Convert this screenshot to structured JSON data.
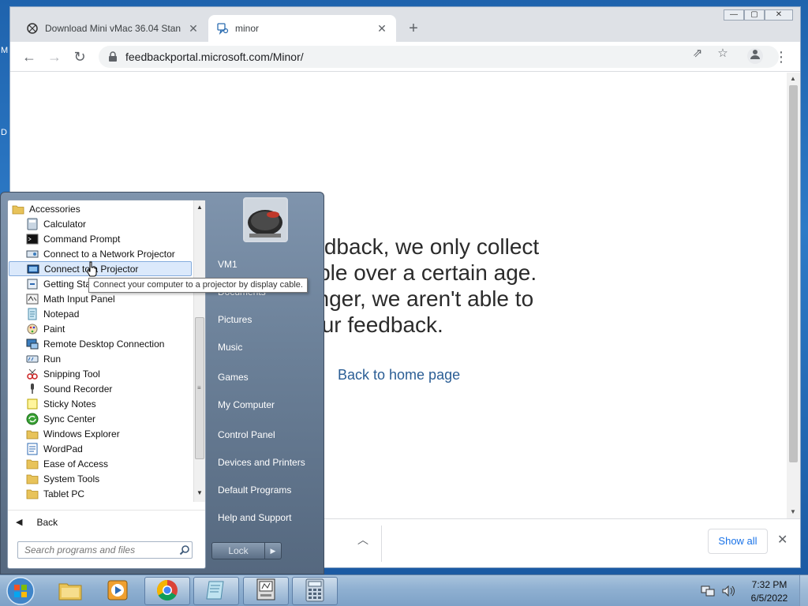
{
  "desktop": {
    "edge_letters": [
      "M",
      "D"
    ]
  },
  "browser": {
    "tabs": [
      {
        "title": "Download Mini vMac 36.04 Stan",
        "favicon": "minivmac-icon"
      },
      {
        "title": "minor",
        "favicon": "feedback-hub-icon"
      }
    ],
    "new_tab": "+",
    "window_controls": {
      "minimize": "—",
      "maximize": "▢",
      "close": "✕"
    },
    "url": "feedbackportal.microsoft.com/Minor/",
    "page": {
      "message": "ue feedback, we only collect\nn people over a certain age.\ne younger, we aren't able to\nect your feedback.",
      "home_link": "Back to home page"
    },
    "download_bar": {
      "show_all": "Show all"
    }
  },
  "start_menu": {
    "folder": "Accessories",
    "items": [
      {
        "label": "Calculator",
        "icon": "calculator-icon"
      },
      {
        "label": "Command Prompt",
        "icon": "command-prompt-icon"
      },
      {
        "label": "Connect to a Network Projector",
        "icon": "network-projector-icon"
      },
      {
        "label": "Connect to a Projector",
        "icon": "projector-icon",
        "selected": true
      },
      {
        "label": "Getting Started",
        "icon": "getting-started-icon"
      },
      {
        "label": "Math Input Panel",
        "icon": "math-input-icon"
      },
      {
        "label": "Notepad",
        "icon": "notepad-icon"
      },
      {
        "label": "Paint",
        "icon": "paint-icon"
      },
      {
        "label": "Remote Desktop Connection",
        "icon": "remote-desktop-icon"
      },
      {
        "label": "Run",
        "icon": "run-icon"
      },
      {
        "label": "Snipping Tool",
        "icon": "snipping-tool-icon"
      },
      {
        "label": "Sound Recorder",
        "icon": "sound-recorder-icon"
      },
      {
        "label": "Sticky Notes",
        "icon": "sticky-notes-icon"
      },
      {
        "label": "Sync Center",
        "icon": "sync-center-icon"
      },
      {
        "label": "Windows Explorer",
        "icon": "windows-explorer-icon"
      },
      {
        "label": "WordPad",
        "icon": "wordpad-icon"
      },
      {
        "label": "Ease of Access",
        "icon": "folder-icon"
      },
      {
        "label": "System Tools",
        "icon": "folder-icon"
      },
      {
        "label": "Tablet PC",
        "icon": "folder-icon"
      }
    ],
    "back": "Back",
    "search_placeholder": "Search programs and files",
    "right_items": [
      "VM1",
      "Documents",
      "Pictures",
      "Music",
      "Games",
      "My Computer",
      "Control Panel",
      "Devices and Printers",
      "Default Programs",
      "Help and Support"
    ],
    "lock": "Lock",
    "tooltip": "Connect your computer to a projector by display cable."
  },
  "taskbar": {
    "apps": [
      "windows-explorer-icon",
      "media-player-icon",
      "chrome-icon",
      "notepad-icon",
      "minivmac-icon",
      "calculator-icon"
    ],
    "time": "7:32 PM",
    "date": "6/5/2022"
  }
}
